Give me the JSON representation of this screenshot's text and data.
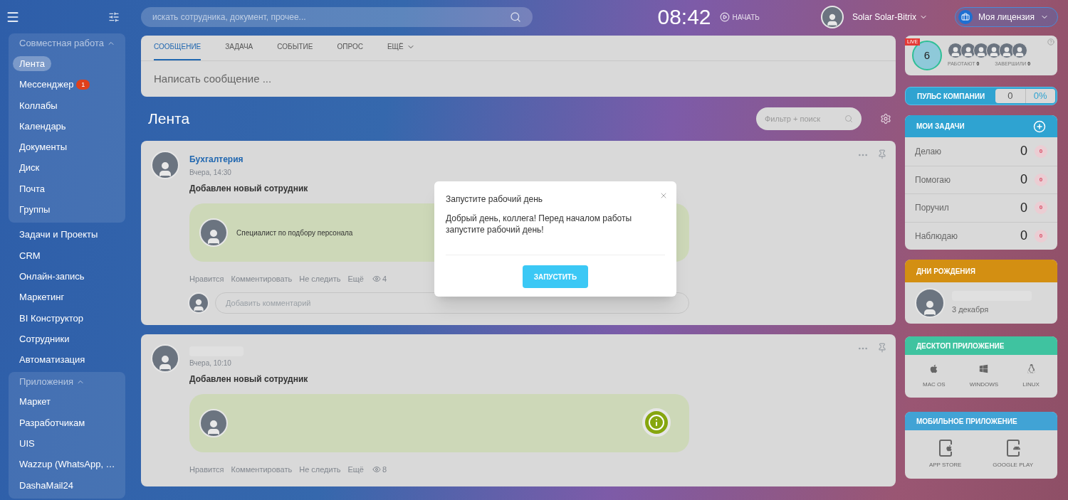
{
  "header": {
    "search_placeholder": "искать сотрудника, документ, прочее...",
    "clock": "08:42",
    "start_label": "НАЧАТЬ",
    "user_name": "Solar Solar-Bitrix",
    "license_label": "Моя лицензия"
  },
  "sidebar": {
    "sections": [
      {
        "kind": "group",
        "title": "Совместная работа",
        "expanded": true,
        "items": [
          {
            "label": "Лента",
            "selected": true
          },
          {
            "label": "Мессенджер",
            "selected": false,
            "badge": "1"
          },
          {
            "label": "Коллабы",
            "selected": false
          },
          {
            "label": "Календарь",
            "selected": false
          },
          {
            "label": "Документы",
            "selected": false
          },
          {
            "label": "Диск",
            "selected": false
          },
          {
            "label": "Почта",
            "selected": false
          },
          {
            "label": "Группы",
            "selected": false
          }
        ]
      },
      {
        "kind": "plain",
        "items": [
          {
            "label": "Задачи и Проекты",
            "selected": false
          },
          {
            "label": "CRM",
            "selected": false
          },
          {
            "label": "Онлайн-запись",
            "selected": false
          },
          {
            "label": "Маркетинг",
            "selected": false
          },
          {
            "label": "BI Конструктор",
            "selected": false
          },
          {
            "label": "Сотрудники",
            "selected": false
          },
          {
            "label": "Автоматизация",
            "selected": false
          }
        ]
      },
      {
        "kind": "group",
        "title": "Приложения",
        "expanded": true,
        "items": [
          {
            "label": "Маркет",
            "selected": false
          },
          {
            "label": "Разработчикам",
            "selected": false
          },
          {
            "label": "UIS",
            "selected": false
          },
          {
            "label": "Wazzup (WhatsApp, …",
            "selected": false
          },
          {
            "label": "DashaMail24",
            "selected": false
          }
        ]
      }
    ]
  },
  "composer": {
    "tabs": [
      {
        "label": "СООБЩЕНИЕ",
        "selected": true,
        "kind": "plain"
      },
      {
        "label": "ЗАДАЧА",
        "selected": false,
        "kind": "plain"
      },
      {
        "label": "СОБЫТИЕ",
        "selected": false,
        "kind": "plain"
      },
      {
        "label": "ОПРОС",
        "selected": false,
        "kind": "plain"
      },
      {
        "label": "ЕЩЁ",
        "selected": false,
        "kind": "menu"
      }
    ],
    "placeholder": "Написать сообщение ..."
  },
  "feed": {
    "title": "Лента",
    "filter_placeholder": "Фильтр + поиск"
  },
  "posts": [
    {
      "author": "Бухгалтерия",
      "time": "Вчера, 14:30",
      "title": "Добавлен новый сотрудник",
      "card_text": "Специалист по подбору персонала",
      "actions": [
        "Нравится",
        "Комментировать",
        "Не следить",
        "Ещё"
      ],
      "views": "4",
      "comment_placeholder": "Добавить комментарий"
    },
    {
      "time": "Вчера, 10:10",
      "title": "Добавлен новый сотрудник",
      "info_badge": true,
      "actions": [
        "Нравится",
        "Комментировать",
        "Не следить",
        "Ещё"
      ],
      "views": "8"
    }
  ],
  "modal": {
    "title": "Запустите рабочий день",
    "text": "Добрый день, коллега! Перед началом работы запустите рабочий день!",
    "button": "ЗАПУСТИТЬ"
  },
  "timeman": {
    "live": "LIVE",
    "count": "6",
    "working_label": "РАБОТАЮТ",
    "working": "0",
    "finished_label": "ЗАВЕРШИЛИ",
    "finished": "0"
  },
  "pulse": {
    "title": "ПУЛЬС КОМПАНИИ",
    "value": "0",
    "percent": "0%"
  },
  "tasks": {
    "title": "МОИ ЗАДАЧИ",
    "rows": [
      {
        "label": "Делаю",
        "count": "0",
        "badge": "0"
      },
      {
        "label": "Помогаю",
        "count": "0",
        "badge": "0"
      },
      {
        "label": "Поручил",
        "count": "0",
        "badge": "0"
      },
      {
        "label": "Наблюдаю",
        "count": "0",
        "badge": "0"
      }
    ]
  },
  "birthdays": {
    "title": "ДНИ РОЖДЕНИЯ",
    "date": "3 декабря"
  },
  "desktop": {
    "title": "ДЕСКТОП ПРИЛОЖЕНИЕ",
    "apps": [
      {
        "label": "MAC OS",
        "kind": "apple"
      },
      {
        "label": "WINDOWS",
        "kind": "windows"
      },
      {
        "label": "LINUX",
        "kind": "linux"
      }
    ]
  },
  "mobile": {
    "title": "МОБИЛЬНОЕ ПРИЛОЖЕНИЕ",
    "apps": [
      {
        "label": "APP STORE",
        "kind": "ios"
      },
      {
        "label": "GOOGLE PLAY",
        "kind": "android"
      }
    ]
  }
}
